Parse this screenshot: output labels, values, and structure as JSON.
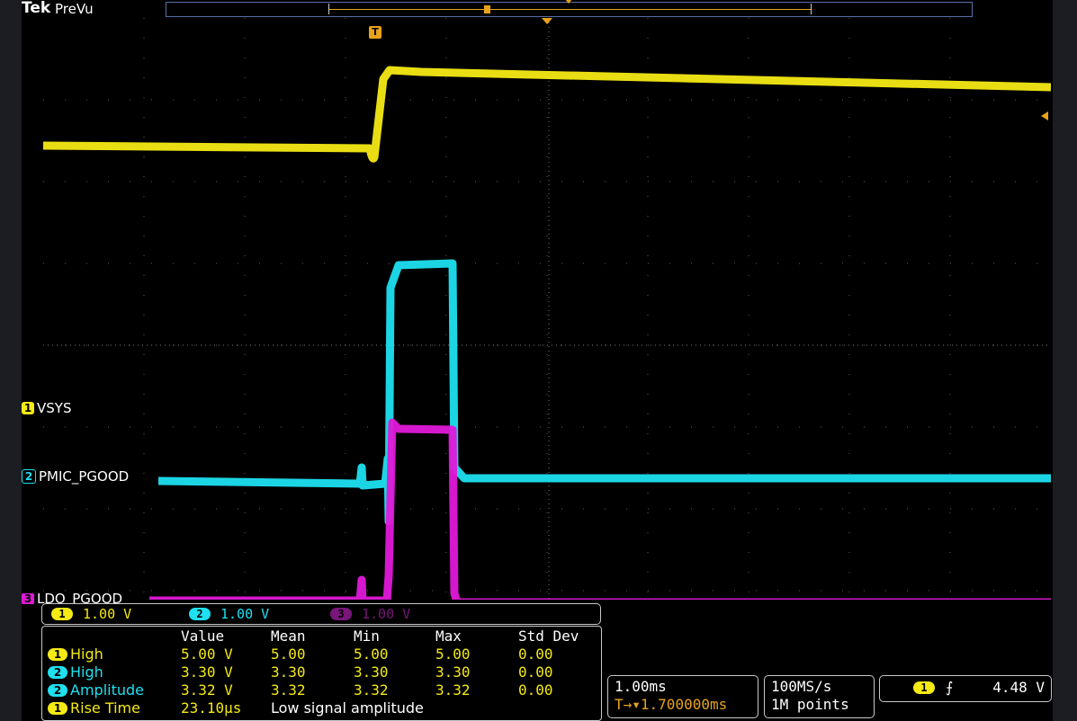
{
  "header": {
    "brand": "Tek",
    "mode": "PreVu",
    "record_trigger_glyph": "T"
  },
  "colors": {
    "ch1": "#f5ea14",
    "ch2": "#1ee0f0",
    "ch3": "#e018d8",
    "trigger": "#e8a31b",
    "grid": "#5c5c5c"
  },
  "trigger_marker": "T",
  "channels": [
    {
      "num": "1",
      "name": "VSYS"
    },
    {
      "num": "2",
      "name": "PMIC_PGOOD"
    },
    {
      "num": "3",
      "name": "LDO_PGOOD"
    }
  ],
  "scales": [
    {
      "num": "1",
      "value": "1.00 V"
    },
    {
      "num": "2",
      "value": "1.00 V"
    },
    {
      "num": "3",
      "value": "1.00 V"
    }
  ],
  "measurements": {
    "headers": [
      "Value",
      "Mean",
      "Min",
      "Max",
      "Std Dev"
    ],
    "rows": [
      {
        "ch": "1",
        "label": "High",
        "value": "5.00 V",
        "mean": "5.00",
        "min": "5.00",
        "max": "5.00",
        "std": "0.00"
      },
      {
        "ch": "2",
        "label": "High",
        "value": "3.30 V",
        "mean": "3.30",
        "min": "3.30",
        "max": "3.30",
        "std": "0.00"
      },
      {
        "ch": "2",
        "label": "Amplitude",
        "value": "3.32 V",
        "mean": "3.32",
        "min": "3.32",
        "max": "3.32",
        "std": "0.00"
      },
      {
        "ch": "1",
        "label": "Rise Time",
        "value": "23.10µs",
        "note": "Low signal amplitude"
      }
    ]
  },
  "horizontal": {
    "scale": "1.00ms",
    "position": "1.700000ms",
    "position_prefix": "T→▾"
  },
  "acquisition": {
    "sample_rate": "100MS/s",
    "record_length": "1M points"
  },
  "trigger": {
    "channel": "1",
    "slope_icon": "rising-edge",
    "level": "4.48 V"
  }
}
